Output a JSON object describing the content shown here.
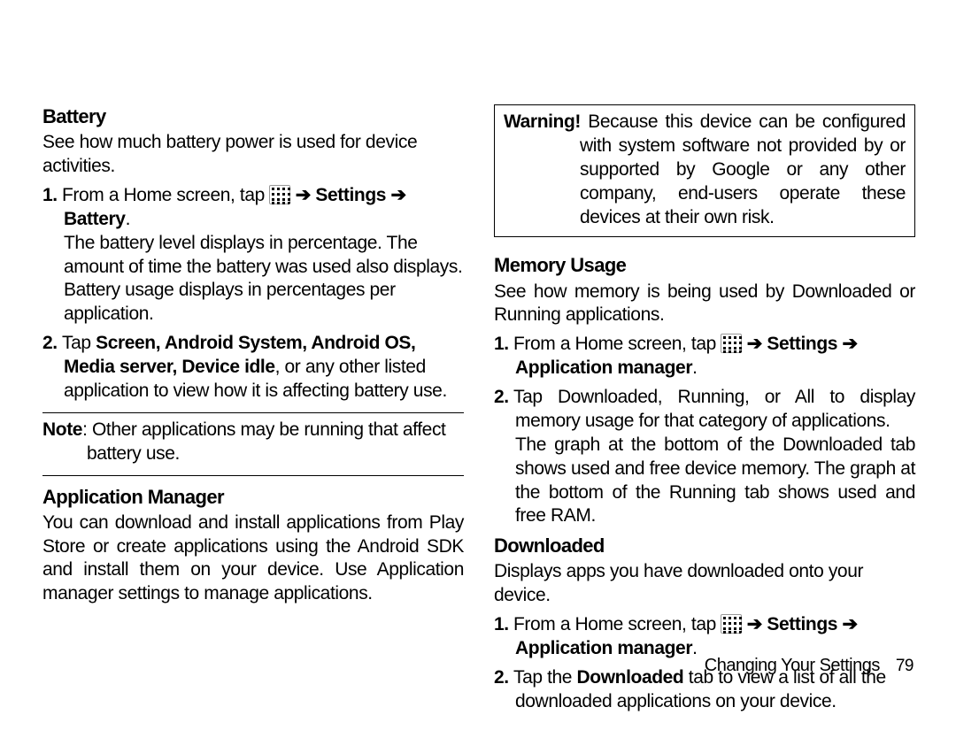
{
  "left": {
    "battery": {
      "heading": "Battery",
      "intro": "See how much battery power is used for device activities.",
      "step1_pre": "From a Home screen, tap ",
      "step1_arrow1": "➔",
      "step1_settings": " Settings ",
      "step1_arrow2": "➔",
      "step1_battery": " Battery",
      "step1_end": ".",
      "step1_body": "The battery level displays in percentage. The amount of time the battery was used also displays. Battery usage displays in percentages per application.",
      "step2_pre": "Tap ",
      "step2_bold": "Screen, Android System, Android OS, Media server, Device idle",
      "step2_post": ", or any other listed application to view how it is affecting battery use.",
      "note_label": "Note",
      "note_body": ": Other applications may be running that affect battery use."
    },
    "appmgr": {
      "heading": "Application Manager",
      "body": "You can download and install applications from Play Store or create applications using the Android SDK and install them on your device. Use Application manager settings to manage applications."
    }
  },
  "right": {
    "warning": {
      "label": "Warning!",
      "body": " Because this device can be configured with system software not provided by or supported by Google or any other company, end-users operate these devices at their own risk."
    },
    "memory": {
      "heading": "Memory Usage",
      "intro": "See how memory is being used by Downloaded or Running applications.",
      "step1_pre": "From a Home screen, tap  ",
      "arrow": "➔",
      "step1_settings": " Settings ",
      "step1_appmgr": " Application manager",
      "step1_end": ".",
      "step2": "Tap Downloaded, Running, or All to display memory usage for that category of applications.",
      "step2_body": "The graph at the bottom of the Downloaded tab shows used and free device memory. The graph at the bottom of the Running tab shows used and free RAM."
    },
    "downloaded": {
      "heading": "Downloaded",
      "intro": "Displays apps you have downloaded onto your device.",
      "step1_pre": "From a Home screen, tap  ",
      "arrow": "➔",
      "step1_settings": " Settings ",
      "step1_appmgr": " Application manager",
      "step1_end": ".",
      "step2_pre": "Tap the ",
      "step2_bold": "Downloaded",
      "step2_post": " tab to view a list of all the downloaded applications on your device."
    }
  },
  "footer": {
    "chapter": "Changing Your Settings",
    "page": "79"
  }
}
